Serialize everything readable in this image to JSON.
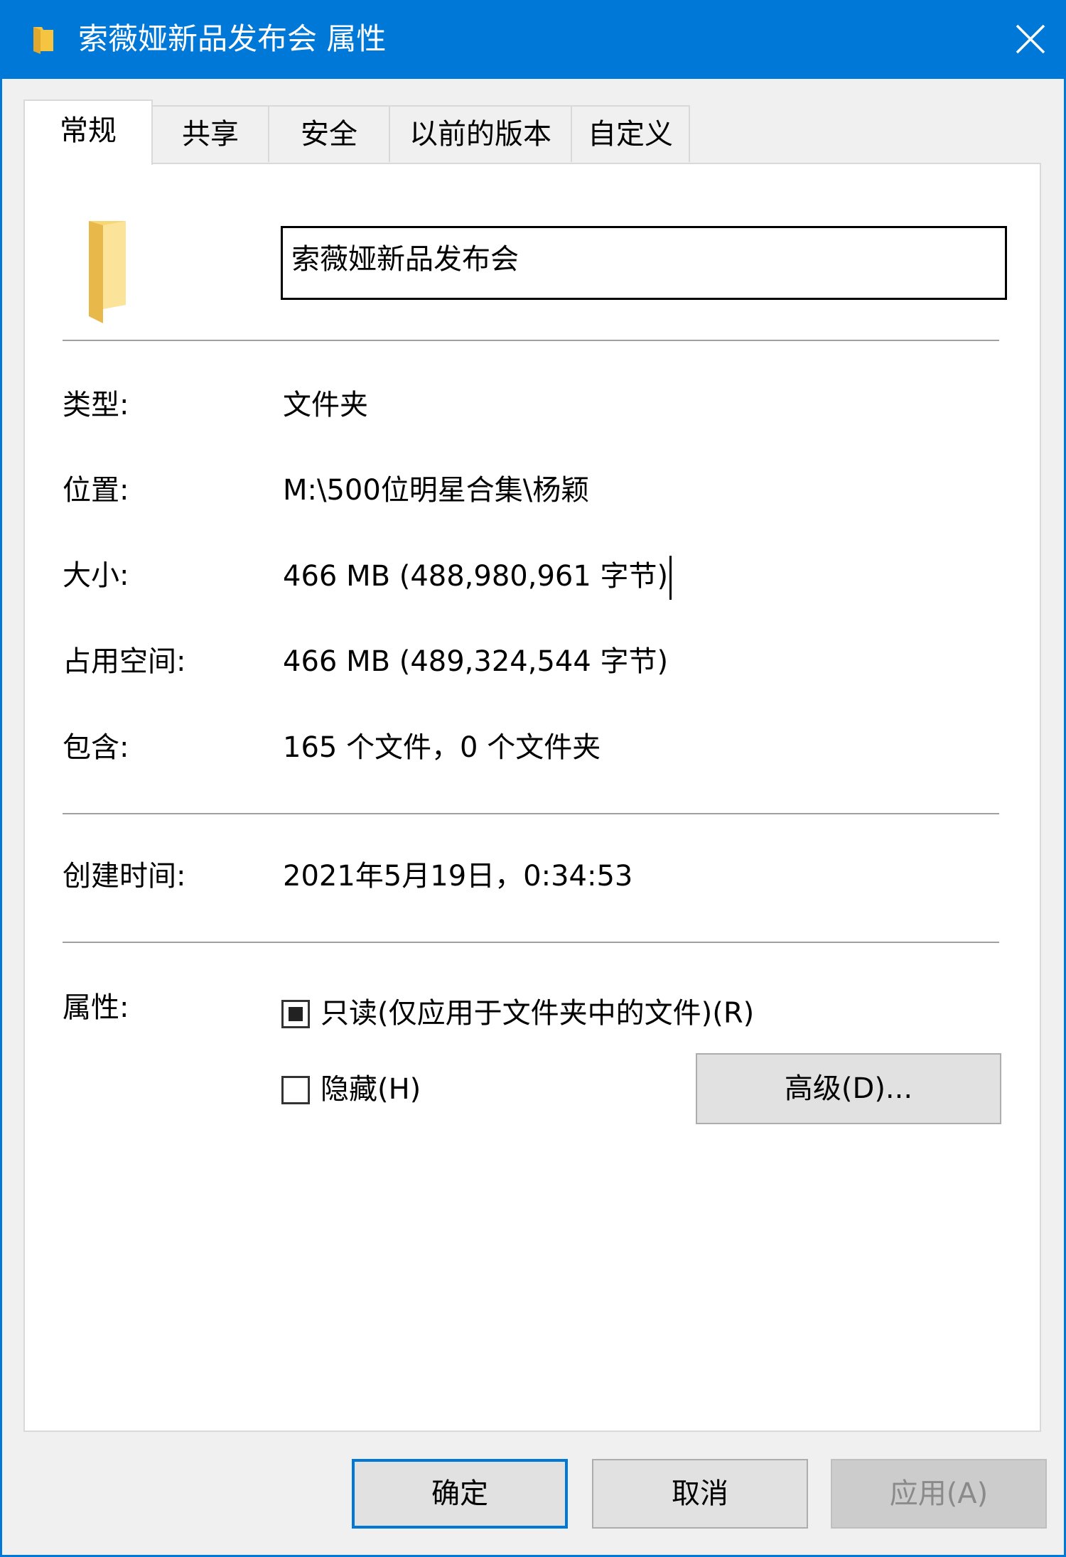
{
  "window": {
    "title": "索薇娅新品发布会 属性",
    "accent_color": "#0078d7"
  },
  "tabs": [
    {
      "label": "常规",
      "active": true
    },
    {
      "label": "共享",
      "active": false
    },
    {
      "label": "安全",
      "active": false
    },
    {
      "label": "以前的版本",
      "active": false
    },
    {
      "label": "自定义",
      "active": false
    }
  ],
  "general": {
    "folder_icon": "folder-icon",
    "name_value": "索薇娅新品发布会",
    "type_label": "类型:",
    "type_value": "文件夹",
    "location_label": "位置:",
    "location_value": "M:\\500位明星合集\\杨颖",
    "size_label": "大小:",
    "size_value": "466 MB (488,980,961 字节)",
    "size_on_disk_label": "占用空间:",
    "size_on_disk_value": "466 MB (489,324,544 字节)",
    "contains_label": "包含:",
    "contains_value": "165 个文件，0 个文件夹",
    "created_label": "创建时间:",
    "created_value": "2021年5月19日，0:34:53",
    "attributes_label": "属性:",
    "readonly_label": "只读(仅应用于文件夹中的文件)(R)",
    "readonly_state": "indeterminate",
    "hidden_label": "隐藏(H)",
    "hidden_checked": false,
    "advanced_label": "高级(D)..."
  },
  "footer": {
    "ok_label": "确定",
    "cancel_label": "取消",
    "apply_label": "应用(A)",
    "apply_enabled": false
  }
}
